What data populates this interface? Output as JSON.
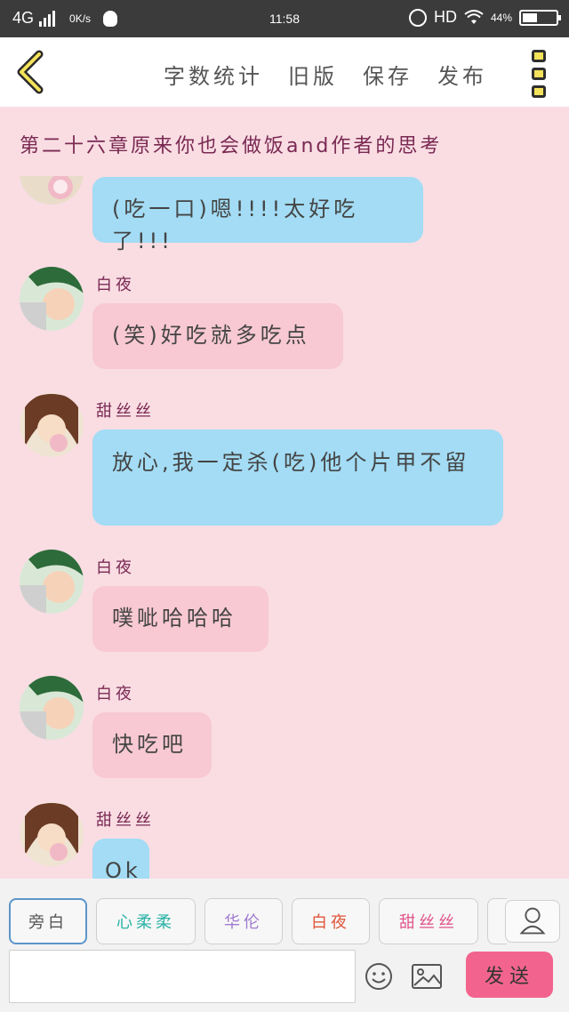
{
  "status_bar": {
    "network": "4G",
    "speed": "0K/s",
    "time": "11:58",
    "hd": "HD",
    "battery_pct": "44%",
    "battery_level": 0.44
  },
  "header": {
    "back_icon": "chevron-left-icon",
    "actions": [
      "字数统计",
      "旧版",
      "保存",
      "发布"
    ],
    "menu_icon": "more-menu-icon"
  },
  "chapter_title": "第二十六章原来你也会做饭and作者的思考",
  "messages": [
    {
      "speaker": "",
      "text": "(吃一口)嗯!!!!太好吃了!!!",
      "style": "blue"
    },
    {
      "speaker": "白夜",
      "text": "(笑)好吃就多吃点",
      "style": "pink"
    },
    {
      "speaker": "甜丝丝",
      "text": "放心,我一定杀(吃)他个片甲不留",
      "style": "blue"
    },
    {
      "speaker": "白夜",
      "text": "噗呲哈哈哈",
      "style": "pink"
    },
    {
      "speaker": "白夜",
      "text": "快吃吧",
      "style": "pink"
    },
    {
      "speaker": "甜丝丝",
      "text": "Ok",
      "style": "blue"
    }
  ],
  "roles": [
    {
      "label": "旁白",
      "color": "#555555"
    },
    {
      "label": "心柔柔",
      "color": "#2bb3a8"
    },
    {
      "label": "华伦",
      "color": "#a07ad0"
    },
    {
      "label": "白夜",
      "color": "#e0553a"
    },
    {
      "label": "甜丝丝",
      "color": "#e0558a"
    }
  ],
  "composer": {
    "input_value": "",
    "emoji_icon": "smiley-icon",
    "image_icon": "image-icon",
    "user_icon": "user-icon",
    "send_label": "发送"
  },
  "colors": {
    "background": "#f9dde3",
    "bubble_blue": "#a3dcf4",
    "bubble_pink": "#f8c9d3",
    "name_color": "#7a2952",
    "send_button": "#f2648e"
  }
}
